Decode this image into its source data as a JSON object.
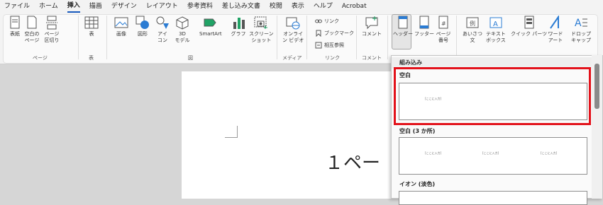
{
  "menu": {
    "tabs": [
      "ファイル",
      "ホーム",
      "挿入",
      "描画",
      "デザイン",
      "レイアウト",
      "参考資料",
      "差し込み文書",
      "校閲",
      "表示",
      "ヘルプ",
      "Acrobat"
    ]
  },
  "ribbon": {
    "pages": {
      "cover": "表紙",
      "blank": "空白の\nページ",
      "break": "ページ\n区切り",
      "group": "ページ"
    },
    "table": {
      "table": "表",
      "group": "表"
    },
    "illustrations": {
      "image": "画像",
      "shapes": "図形",
      "icons": "アイ\nコン",
      "model3d": "3D\nモデル",
      "smartart": "SmartArt",
      "chart": "グラフ",
      "screenshot": "スクリーン\nショット",
      "group": "図"
    },
    "media": {
      "video": "オンライ\nン ビデオ",
      "group": "メディア"
    },
    "links": {
      "link": "リンク",
      "bookmark": "ブックマーク",
      "crossref": "相互参照",
      "group": "リンク"
    },
    "comments": {
      "comment": "コメント",
      "group": "コメント"
    },
    "header_footer": {
      "header": "ヘッダー",
      "footer": "フッター",
      "page_number": "ページ\n番号"
    },
    "text": {
      "greeting": "あいさつ\n文",
      "textbox": "テキスト\nボックス",
      "quickparts": "クイック パーツ",
      "wordart": "ワード\nアート",
      "dropcap": "ドロップ\nキャップ"
    }
  },
  "document": {
    "text": "１ペー"
  },
  "gallery": {
    "section": "組み込み",
    "items": [
      {
        "title": "空白",
        "placeholders": [
          "[ここに入力]"
        ]
      },
      {
        "title": "空白 (3 か所)",
        "placeholders": [
          "[ここに入力]",
          "[ここに入力]",
          "[ここに入力]"
        ]
      },
      {
        "title": "イオン (淡色)",
        "placeholders": []
      }
    ]
  },
  "colors": {
    "highlight": "#e3121b",
    "accent": "#185abd"
  }
}
